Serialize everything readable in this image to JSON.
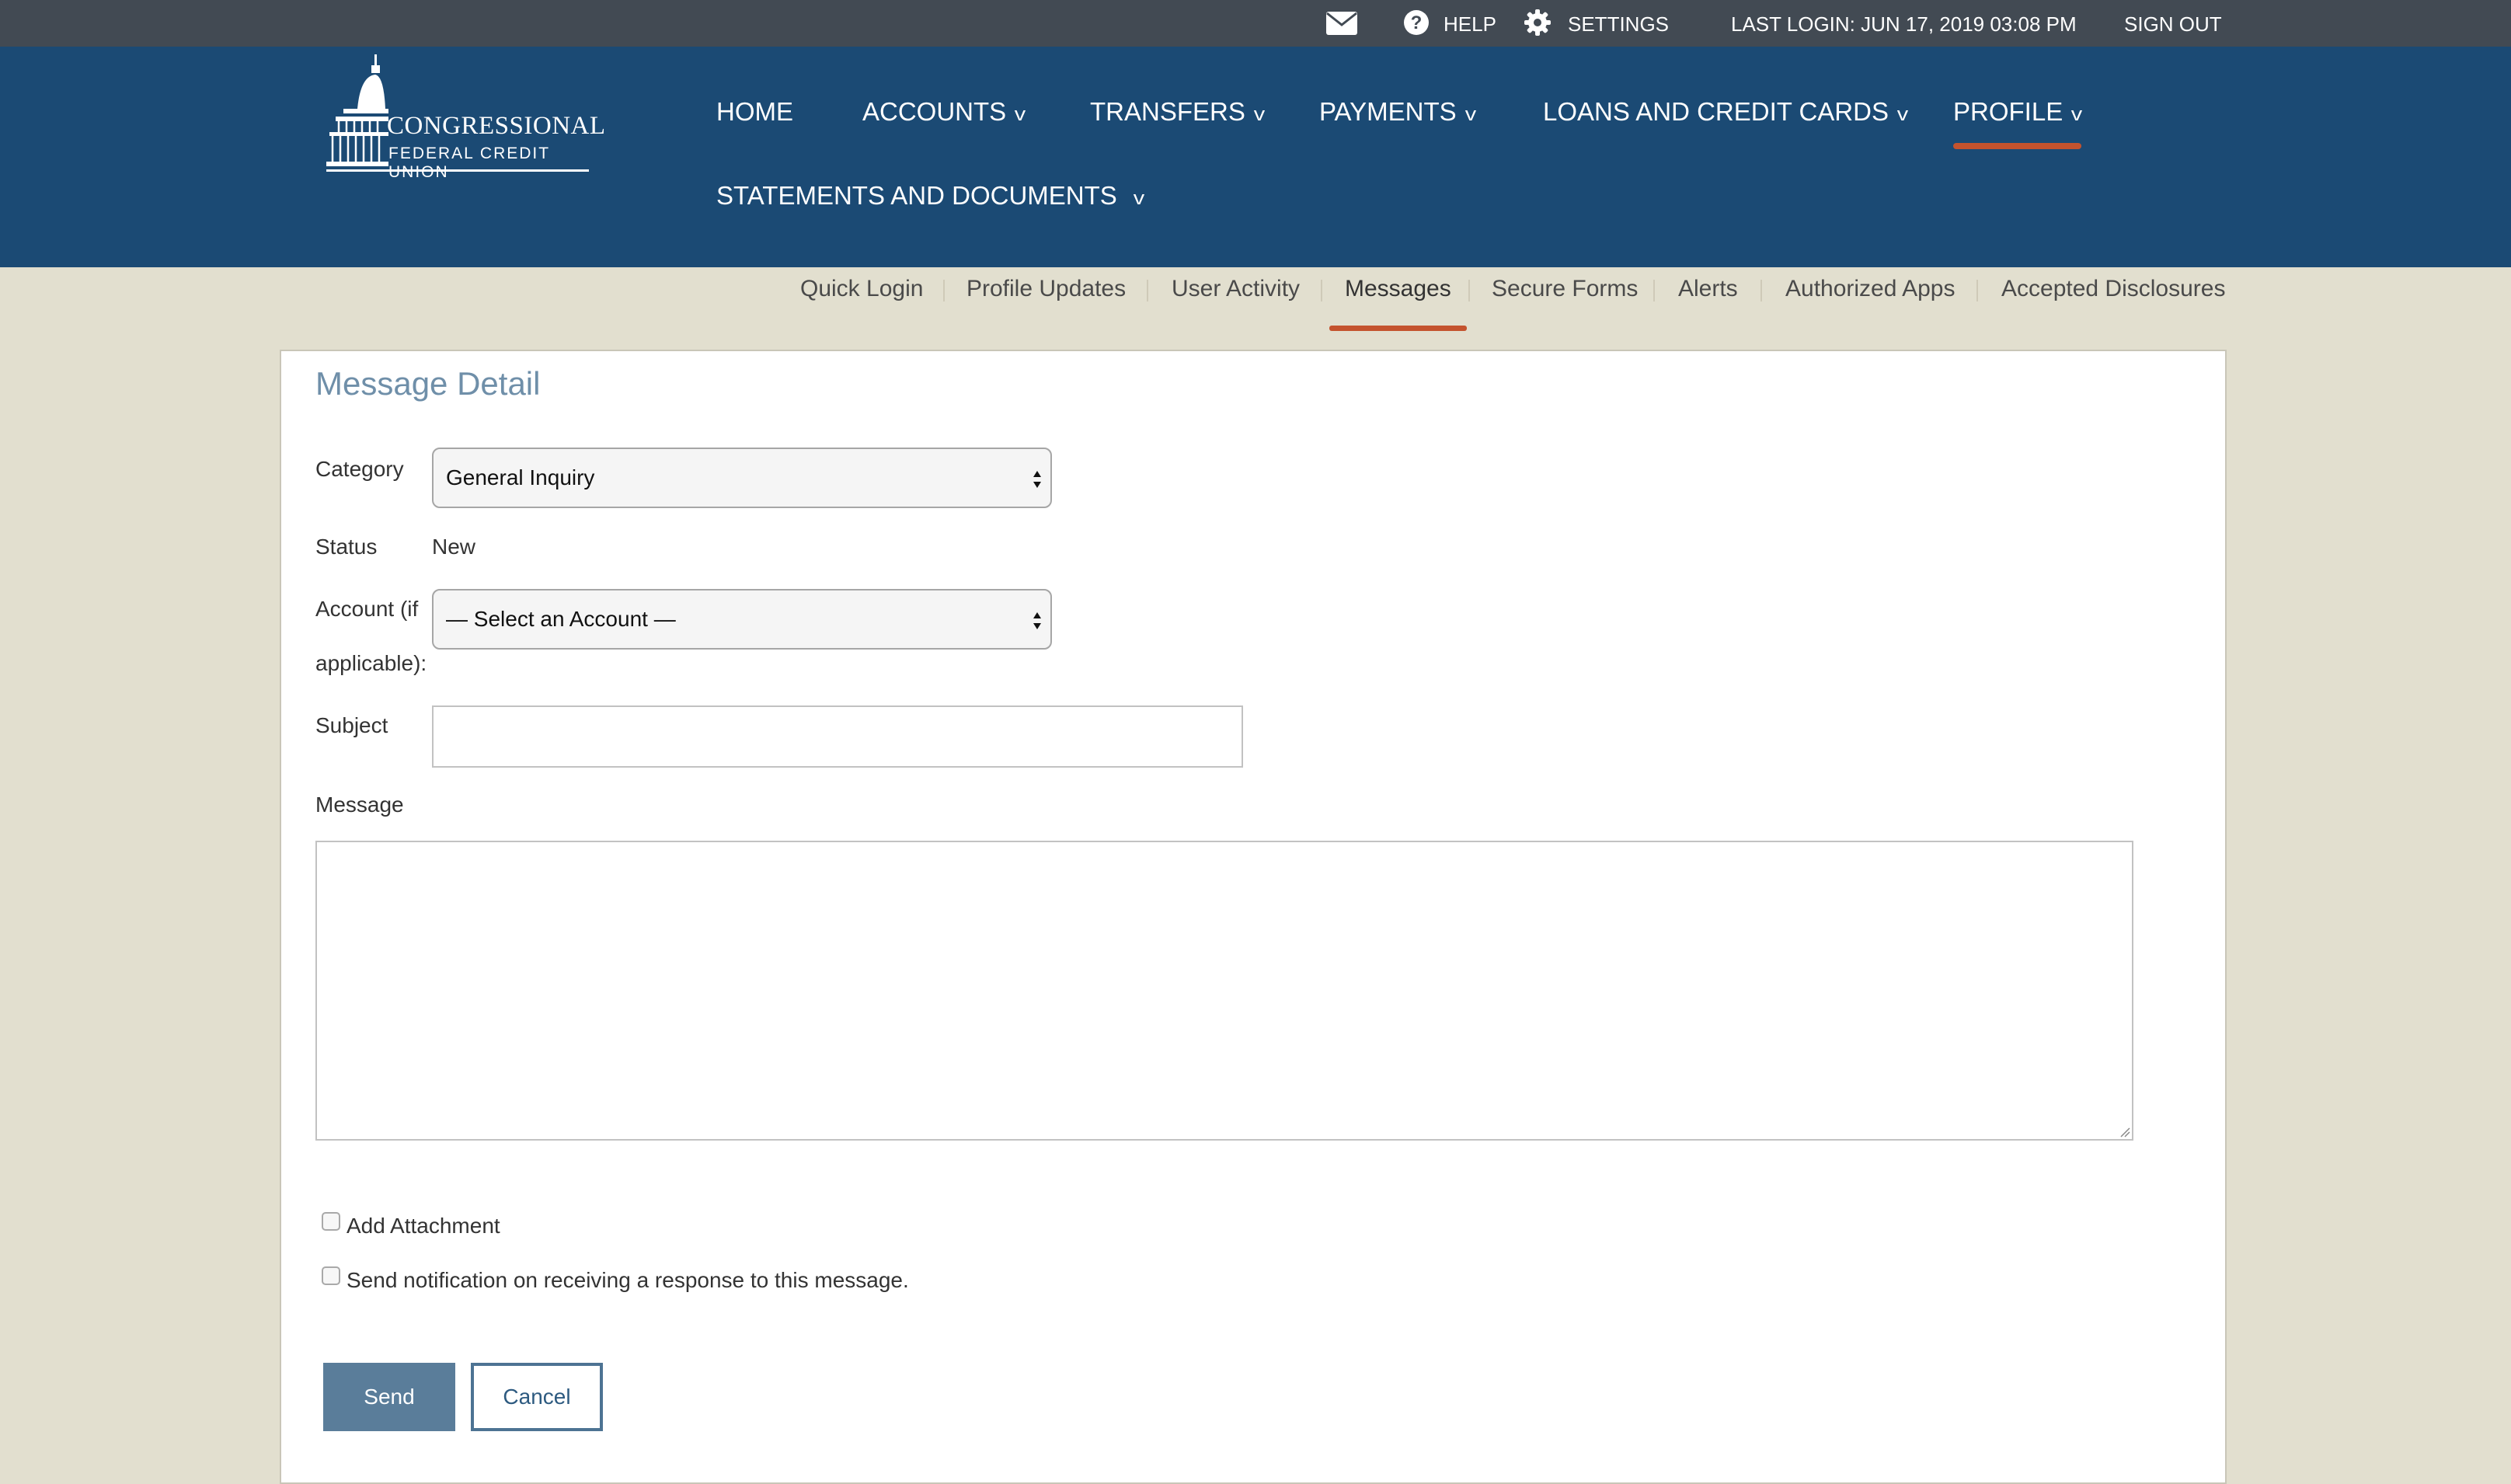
{
  "utility_bar": {
    "help_label": "HELP",
    "settings_label": "SETTINGS",
    "last_login": "LAST LOGIN: JUN 17, 2019 03:08 PM",
    "sign_out_label": "SIGN OUT"
  },
  "logo": {
    "line1": "CONGRESSIONAL",
    "line2": "FEDERAL CREDIT UNION"
  },
  "main_nav": {
    "items": [
      {
        "label": "HOME",
        "has_dropdown": false
      },
      {
        "label": "ACCOUNTS",
        "has_dropdown": true
      },
      {
        "label": "TRANSFERS",
        "has_dropdown": true
      },
      {
        "label": "PAYMENTS",
        "has_dropdown": true
      },
      {
        "label": "LOANS AND CREDIT CARDS",
        "has_dropdown": true
      },
      {
        "label": "PROFILE",
        "has_dropdown": true,
        "active": true
      },
      {
        "label": "STATEMENTS AND DOCUMENTS",
        "has_dropdown": true
      }
    ],
    "chevron": "v"
  },
  "sub_nav": {
    "items": [
      {
        "label": "Quick Login"
      },
      {
        "label": "Profile Updates"
      },
      {
        "label": "User Activity"
      },
      {
        "label": "Messages",
        "active": true
      },
      {
        "label": "Secure Forms"
      },
      {
        "label": "Alerts"
      },
      {
        "label": "Authorized Apps"
      },
      {
        "label": "Accepted Disclosures"
      }
    ]
  },
  "form": {
    "title": "Message Detail",
    "category_label": "Category",
    "category_value": "General Inquiry",
    "status_label": "Status",
    "status_value": "New",
    "account_label_line1": "Account (if",
    "account_label_line2": "applicable):",
    "account_value": "— Select an Account —",
    "subject_label": "Subject",
    "subject_value": "",
    "message_label": "Message",
    "message_value": "",
    "add_attachment_label": "Add Attachment",
    "add_attachment_checked": false,
    "notify_label": "Send notification on receiving a response to this message.",
    "notify_checked": false,
    "send_label": "Send",
    "cancel_label": "Cancel"
  },
  "colors": {
    "utility_bar_bg": "#424a53",
    "nav_bg": "#1b4a74",
    "page_bg": "#e2dfcf",
    "active_underline": "#c4532e",
    "title_color": "#6f8fa9",
    "primary_button": "#5a7d9a"
  }
}
